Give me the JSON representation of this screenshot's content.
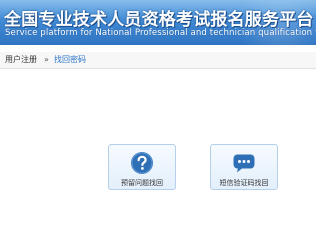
{
  "header": {
    "title": "全国专业技术人员资格考试报名服务平台",
    "subtitle": "Service platform for National Professional and technician  qualification test"
  },
  "breadcrumb": {
    "items": [
      "用户注册",
      "找回密码"
    ],
    "separator": "»"
  },
  "options": [
    {
      "label": "预留问题找回",
      "icon": "question-mark-icon"
    },
    {
      "label": "短信验证码找回",
      "icon": "sms-message-icon"
    }
  ],
  "colors": {
    "banner": "#3d86d2",
    "link": "#2a74c7",
    "icon": "#2f6fb5",
    "card_border": "#b6cfea"
  }
}
